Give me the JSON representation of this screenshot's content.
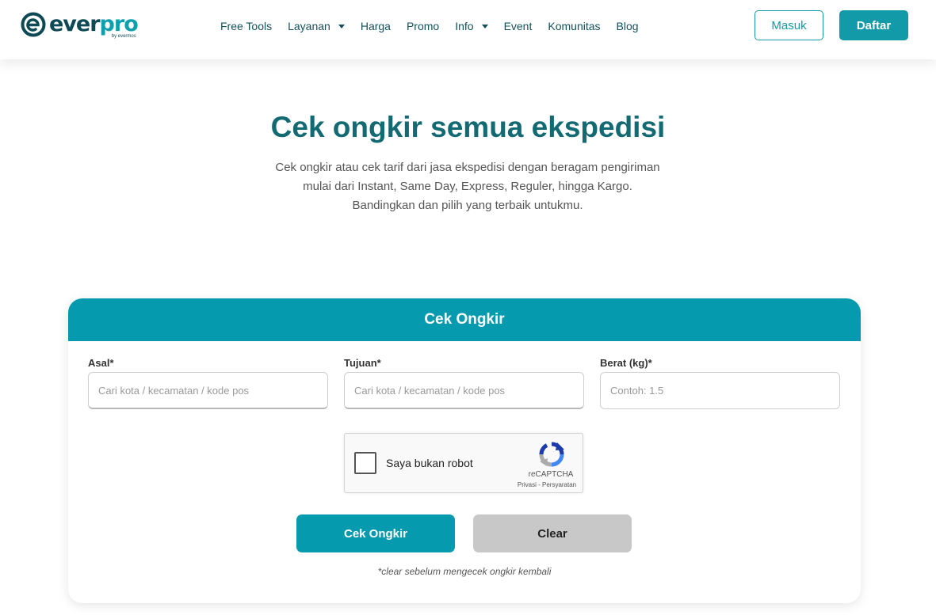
{
  "brand": {
    "name_part1": "ever",
    "name_part2": "pro",
    "tagline": "by evermos",
    "colors": {
      "primary": "#069aae",
      "dark": "#0e4a55"
    }
  },
  "nav": {
    "items": [
      {
        "label": "Free Tools",
        "dropdown": false
      },
      {
        "label": "Layanan",
        "dropdown": true
      },
      {
        "label": "Harga",
        "dropdown": false
      },
      {
        "label": "Promo",
        "dropdown": false
      },
      {
        "label": "Info",
        "dropdown": true
      },
      {
        "label": "Event",
        "dropdown": false
      },
      {
        "label": "Komunitas",
        "dropdown": false
      },
      {
        "label": "Blog",
        "dropdown": false
      }
    ],
    "login_label": "Masuk",
    "register_label": "Daftar"
  },
  "hero": {
    "title": "Cek ongkir semua ekspedisi",
    "description_lines": [
      "Cek ongkir atau cek tarif dari jasa ekspedisi dengan beragam pengiriman",
      "mulai dari Instant, Same Day, Express, Reguler, hingga Kargo.",
      "Bandingkan dan pilih yang terbaik untukmu."
    ]
  },
  "form": {
    "header": "Cek Ongkir",
    "origin": {
      "label": "Asal*",
      "placeholder": "Cari kota / kecamatan / kode pos"
    },
    "destination": {
      "label": "Tujuan*",
      "placeholder": "Cari kota / kecamatan / kode pos"
    },
    "weight": {
      "label": "Berat (kg)*",
      "placeholder": "Contoh: 1.5"
    },
    "recaptcha": {
      "label": "Saya bukan robot",
      "brand": "reCAPTCHA",
      "links": "Privasi - Persyaratan"
    },
    "submit_label": "Cek Ongkir",
    "clear_label": "Clear",
    "note": "*clear sebelum mengecek ongkir kembali"
  }
}
